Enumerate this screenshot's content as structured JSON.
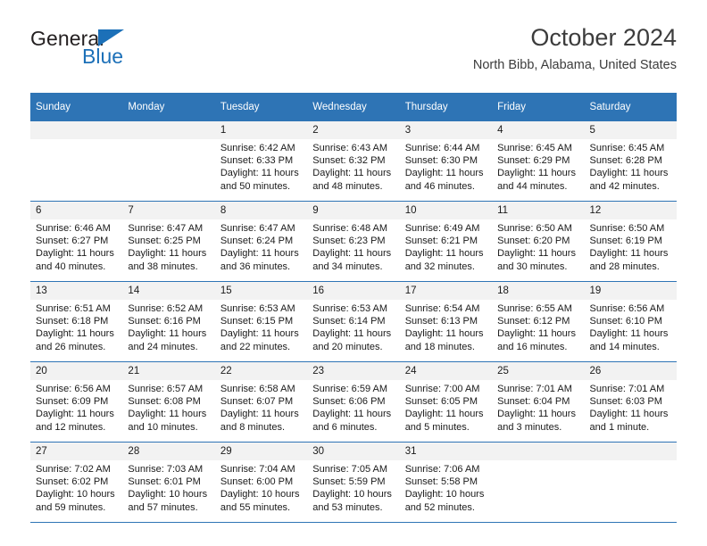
{
  "brand": {
    "name_top": "General",
    "name_bottom": "Blue",
    "accent_color": "#1c70b8"
  },
  "header": {
    "month_title": "October 2024",
    "location": "North Bibb, Alabama, United States"
  },
  "theme": {
    "header_row_bg": "#2e74b5",
    "daynum_bg": "#f2f2f2",
    "text_color": "#1a1a1a"
  },
  "weekday_headers": [
    "Sunday",
    "Monday",
    "Tuesday",
    "Wednesday",
    "Thursday",
    "Friday",
    "Saturday"
  ],
  "labels": {
    "sunrise": "Sunrise:",
    "sunset": "Sunset:",
    "daylight": "Daylight:"
  },
  "weeks": [
    [
      {
        "day": "",
        "sunrise": "",
        "sunset": "",
        "daylight": ""
      },
      {
        "day": "",
        "sunrise": "",
        "sunset": "",
        "daylight": ""
      },
      {
        "day": "1",
        "sunrise": "Sunrise: 6:42 AM",
        "sunset": "Sunset: 6:33 PM",
        "daylight": "Daylight: 11 hours and 50 minutes."
      },
      {
        "day": "2",
        "sunrise": "Sunrise: 6:43 AM",
        "sunset": "Sunset: 6:32 PM",
        "daylight": "Daylight: 11 hours and 48 minutes."
      },
      {
        "day": "3",
        "sunrise": "Sunrise: 6:44 AM",
        "sunset": "Sunset: 6:30 PM",
        "daylight": "Daylight: 11 hours and 46 minutes."
      },
      {
        "day": "4",
        "sunrise": "Sunrise: 6:45 AM",
        "sunset": "Sunset: 6:29 PM",
        "daylight": "Daylight: 11 hours and 44 minutes."
      },
      {
        "day": "5",
        "sunrise": "Sunrise: 6:45 AM",
        "sunset": "Sunset: 6:28 PM",
        "daylight": "Daylight: 11 hours and 42 minutes."
      }
    ],
    [
      {
        "day": "6",
        "sunrise": "Sunrise: 6:46 AM",
        "sunset": "Sunset: 6:27 PM",
        "daylight": "Daylight: 11 hours and 40 minutes."
      },
      {
        "day": "7",
        "sunrise": "Sunrise: 6:47 AM",
        "sunset": "Sunset: 6:25 PM",
        "daylight": "Daylight: 11 hours and 38 minutes."
      },
      {
        "day": "8",
        "sunrise": "Sunrise: 6:47 AM",
        "sunset": "Sunset: 6:24 PM",
        "daylight": "Daylight: 11 hours and 36 minutes."
      },
      {
        "day": "9",
        "sunrise": "Sunrise: 6:48 AM",
        "sunset": "Sunset: 6:23 PM",
        "daylight": "Daylight: 11 hours and 34 minutes."
      },
      {
        "day": "10",
        "sunrise": "Sunrise: 6:49 AM",
        "sunset": "Sunset: 6:21 PM",
        "daylight": "Daylight: 11 hours and 32 minutes."
      },
      {
        "day": "11",
        "sunrise": "Sunrise: 6:50 AM",
        "sunset": "Sunset: 6:20 PM",
        "daylight": "Daylight: 11 hours and 30 minutes."
      },
      {
        "day": "12",
        "sunrise": "Sunrise: 6:50 AM",
        "sunset": "Sunset: 6:19 PM",
        "daylight": "Daylight: 11 hours and 28 minutes."
      }
    ],
    [
      {
        "day": "13",
        "sunrise": "Sunrise: 6:51 AM",
        "sunset": "Sunset: 6:18 PM",
        "daylight": "Daylight: 11 hours and 26 minutes."
      },
      {
        "day": "14",
        "sunrise": "Sunrise: 6:52 AM",
        "sunset": "Sunset: 6:16 PM",
        "daylight": "Daylight: 11 hours and 24 minutes."
      },
      {
        "day": "15",
        "sunrise": "Sunrise: 6:53 AM",
        "sunset": "Sunset: 6:15 PM",
        "daylight": "Daylight: 11 hours and 22 minutes."
      },
      {
        "day": "16",
        "sunrise": "Sunrise: 6:53 AM",
        "sunset": "Sunset: 6:14 PM",
        "daylight": "Daylight: 11 hours and 20 minutes."
      },
      {
        "day": "17",
        "sunrise": "Sunrise: 6:54 AM",
        "sunset": "Sunset: 6:13 PM",
        "daylight": "Daylight: 11 hours and 18 minutes."
      },
      {
        "day": "18",
        "sunrise": "Sunrise: 6:55 AM",
        "sunset": "Sunset: 6:12 PM",
        "daylight": "Daylight: 11 hours and 16 minutes."
      },
      {
        "day": "19",
        "sunrise": "Sunrise: 6:56 AM",
        "sunset": "Sunset: 6:10 PM",
        "daylight": "Daylight: 11 hours and 14 minutes."
      }
    ],
    [
      {
        "day": "20",
        "sunrise": "Sunrise: 6:56 AM",
        "sunset": "Sunset: 6:09 PM",
        "daylight": "Daylight: 11 hours and 12 minutes."
      },
      {
        "day": "21",
        "sunrise": "Sunrise: 6:57 AM",
        "sunset": "Sunset: 6:08 PM",
        "daylight": "Daylight: 11 hours and 10 minutes."
      },
      {
        "day": "22",
        "sunrise": "Sunrise: 6:58 AM",
        "sunset": "Sunset: 6:07 PM",
        "daylight": "Daylight: 11 hours and 8 minutes."
      },
      {
        "day": "23",
        "sunrise": "Sunrise: 6:59 AM",
        "sunset": "Sunset: 6:06 PM",
        "daylight": "Daylight: 11 hours and 6 minutes."
      },
      {
        "day": "24",
        "sunrise": "Sunrise: 7:00 AM",
        "sunset": "Sunset: 6:05 PM",
        "daylight": "Daylight: 11 hours and 5 minutes."
      },
      {
        "day": "25",
        "sunrise": "Sunrise: 7:01 AM",
        "sunset": "Sunset: 6:04 PM",
        "daylight": "Daylight: 11 hours and 3 minutes."
      },
      {
        "day": "26",
        "sunrise": "Sunrise: 7:01 AM",
        "sunset": "Sunset: 6:03 PM",
        "daylight": "Daylight: 11 hours and 1 minute."
      }
    ],
    [
      {
        "day": "27",
        "sunrise": "Sunrise: 7:02 AM",
        "sunset": "Sunset: 6:02 PM",
        "daylight": "Daylight: 10 hours and 59 minutes."
      },
      {
        "day": "28",
        "sunrise": "Sunrise: 7:03 AM",
        "sunset": "Sunset: 6:01 PM",
        "daylight": "Daylight: 10 hours and 57 minutes."
      },
      {
        "day": "29",
        "sunrise": "Sunrise: 7:04 AM",
        "sunset": "Sunset: 6:00 PM",
        "daylight": "Daylight: 10 hours and 55 minutes."
      },
      {
        "day": "30",
        "sunrise": "Sunrise: 7:05 AM",
        "sunset": "Sunset: 5:59 PM",
        "daylight": "Daylight: 10 hours and 53 minutes."
      },
      {
        "day": "31",
        "sunrise": "Sunrise: 7:06 AM",
        "sunset": "Sunset: 5:58 PM",
        "daylight": "Daylight: 10 hours and 52 minutes."
      },
      {
        "day": "",
        "sunrise": "",
        "sunset": "",
        "daylight": ""
      },
      {
        "day": "",
        "sunrise": "",
        "sunset": "",
        "daylight": ""
      }
    ]
  ]
}
